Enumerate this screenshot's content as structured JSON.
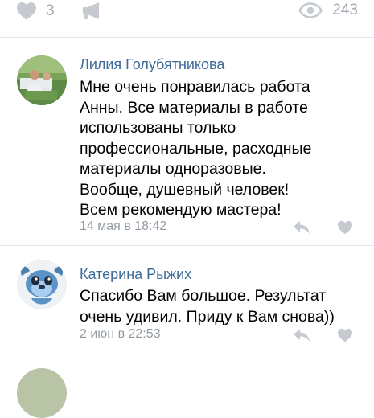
{
  "post_actions": {
    "like_count": "3",
    "views_count": "243",
    "icons": {
      "like": "heart-icon",
      "repost": "megaphone-icon",
      "views": "eye-icon"
    }
  },
  "comments": [
    {
      "author": "Лилия Голубятникова",
      "text": "Мне очень понравилась работа\nАнны. Все материалы в работе\nиспользованы только\nпрофессиональные,  расходные\nматериалы одноразовые.\nВообще, душевный человек!\nВсем рекомендую мастера!",
      "date": "14 мая в 18:42"
    },
    {
      "author": "Катерина Рыжих",
      "text": "Спасибо Вам большое. Результат\nочень удивил. Приду к Вам снова))",
      "date": "2 июн в 22:53"
    }
  ],
  "colors": {
    "author_link": "#3e6b99",
    "meta_text": "#939aa3",
    "icon_gray": "#c5cad1",
    "divider": "#e3e6ea"
  }
}
